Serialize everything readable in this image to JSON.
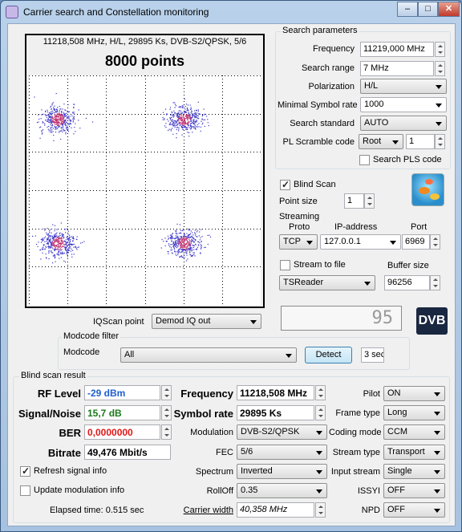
{
  "window": {
    "title": "Carrier search and Constellation monitoring",
    "minimize": "–",
    "maximize": "□",
    "close": "✕"
  },
  "plot": {
    "header": "11218,508 MHz, H/L, 29895 Ks, DVB-S2/QPSK, 5/6",
    "points": "8000 points"
  },
  "search": {
    "group_title": "Search parameters",
    "frequency_label": "Frequency",
    "frequency": "11219,000 MHz",
    "range_label": "Search range",
    "range": "7 MHz",
    "polarization_label": "Polarization",
    "polarization": "H/L",
    "min_symbol_rate_label": "Minimal Symbol rate",
    "min_symbol_rate": "1000",
    "standard_label": "Search standard",
    "standard": "AUTO",
    "pl_scramble_label": "PL Scramble code",
    "pl_scramble_mode": "Root",
    "pl_scramble_value": "1",
    "search_pls_label": "Search PLS code"
  },
  "blind": {
    "blind_scan_label": "Blind Scan",
    "point_size_label": "Point size",
    "point_size": "1"
  },
  "streaming": {
    "title": "Streaming",
    "proto_label": "Proto",
    "ip_label": "IP-address",
    "port_label": "Port",
    "proto": "TCP",
    "ip": "127.0.0.1",
    "port": "6969",
    "stream_to_file_label": "Stream to file",
    "buffer_size_label": "Buffer size",
    "target": "TSReader",
    "buffer_size": "96256"
  },
  "iq": {
    "label": "IQScan point",
    "value": "Demod IQ out"
  },
  "modcode": {
    "group_title": "Modcode filter",
    "label": "Modcode",
    "value": "All",
    "detect": "Detect",
    "timeout": "3 sec"
  },
  "lcd_value": "95",
  "dvb_logo": "DVB",
  "result": {
    "group_title": "Blind scan result",
    "rf_label": "RF Level",
    "rf": "-29 dBm",
    "snr_label": "Signal/Noise",
    "snr": "15,7 dB",
    "ber_label": "BER",
    "ber": "0,0000000",
    "bitrate_label": "Bitrate",
    "bitrate": "49,476 Mbit/s",
    "refresh_label": "Refresh signal info",
    "update_label": "Update modulation info",
    "elapsed": "Elapsed time: 0.515 sec",
    "freq_label": "Frequency",
    "freq": "11218,508 MHz",
    "sr_label": "Symbol rate",
    "sr": "29895 Ks",
    "modulation_label": "Modulation",
    "modulation": "DVB-S2/QPSK",
    "fec_label": "FEC",
    "fec": "5/6",
    "spectrum_label": "Spectrum",
    "spectrum": "Inverted",
    "rolloff_label": "RollOff",
    "rolloff": "0.35",
    "carrier_width_label": "Carrier width",
    "carrier_width": "40,358 MHz",
    "pilot_label": "Pilot",
    "pilot": "ON",
    "frame_label": "Frame type",
    "frame": "Long",
    "coding_label": "Coding mode",
    "coding": "CCM",
    "stream_type_label": "Stream type",
    "stream_type": "Transport",
    "input_stream_label": "Input stream",
    "input_stream": "Single",
    "issyi_label": "ISSYI",
    "issyi": "OFF",
    "npd_label": "NPD",
    "npd": "OFF"
  },
  "colors": {
    "rf": "#1f5fd0",
    "snr": "#1a7a1a",
    "ber": "#e01818",
    "points": "#3a36c8",
    "points_core": "#c0306e"
  }
}
